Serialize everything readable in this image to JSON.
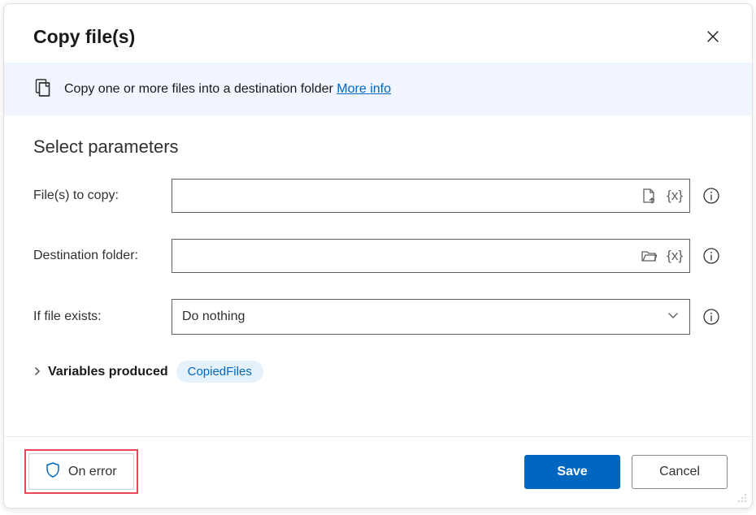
{
  "header": {
    "title": "Copy file(s)",
    "close_icon": "close"
  },
  "banner": {
    "icon": "copy-files",
    "text": "Copy one or more files into a destination folder ",
    "link": "More info"
  },
  "section": {
    "title": "Select parameters"
  },
  "fields": {
    "files": {
      "label": "File(s) to copy:",
      "value": ""
    },
    "destination": {
      "label": "Destination folder:",
      "value": ""
    },
    "ifExists": {
      "label": "If file exists:",
      "selected": "Do nothing"
    }
  },
  "variables": {
    "label": "Variables produced",
    "chips": [
      "CopiedFiles"
    ]
  },
  "footer": {
    "onError": "On error",
    "save": "Save",
    "cancel": "Cancel"
  },
  "colors": {
    "accent": "#0067c0",
    "bannerBg": "#f0f5ff",
    "highlight": "#e74856"
  }
}
